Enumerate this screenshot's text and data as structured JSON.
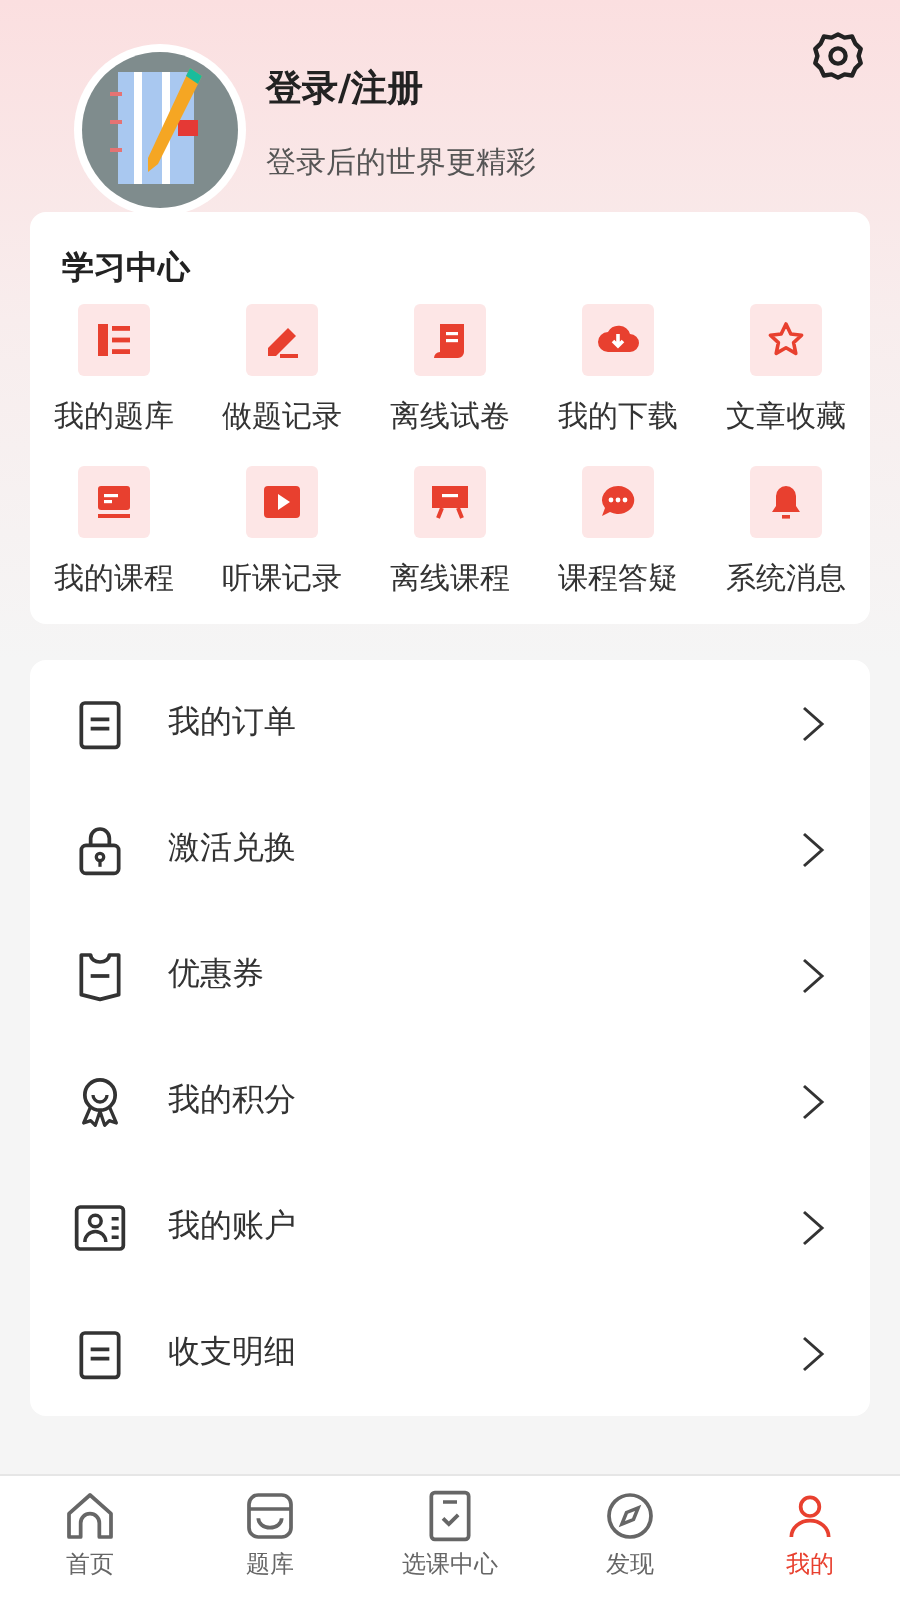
{
  "profile": {
    "title": "登录/注册",
    "subtitle": "登录后的世界更精彩"
  },
  "study_center": {
    "title": "学习中心",
    "items": [
      {
        "label": "我的题库",
        "kind": "list"
      },
      {
        "label": "做题记录",
        "kind": "pencil"
      },
      {
        "label": "离线试卷",
        "kind": "scroll"
      },
      {
        "label": "我的下载",
        "kind": "download"
      },
      {
        "label": "文章收藏",
        "kind": "star"
      },
      {
        "label": "我的课程",
        "kind": "screen"
      },
      {
        "label": "听课记录",
        "kind": "play"
      },
      {
        "label": "离线课程",
        "kind": "board"
      },
      {
        "label": "课程答疑",
        "kind": "chat"
      },
      {
        "label": "系统消息",
        "kind": "bell"
      }
    ]
  },
  "menu": [
    {
      "label": "我的订单",
      "kind": "order"
    },
    {
      "label": "激活兑换",
      "kind": "lock"
    },
    {
      "label": "优惠券",
      "kind": "coupon"
    },
    {
      "label": "我的积分",
      "kind": "medal"
    },
    {
      "label": "我的账户",
      "kind": "account"
    },
    {
      "label": "收支明细",
      "kind": "order"
    }
  ],
  "tabs": [
    {
      "label": "首页",
      "kind": "home",
      "selected": false
    },
    {
      "label": "题库",
      "kind": "store",
      "selected": false
    },
    {
      "label": "选课中心",
      "kind": "check",
      "selected": false
    },
    {
      "label": "发现",
      "kind": "compass",
      "selected": false
    },
    {
      "label": "我的",
      "kind": "user",
      "selected": true
    }
  ]
}
